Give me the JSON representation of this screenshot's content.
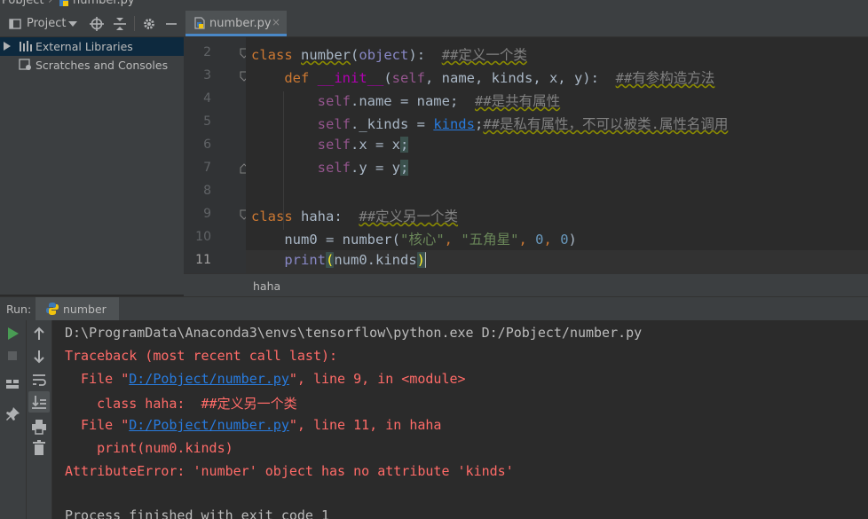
{
  "breadcrumbs": [
    "Pobject",
    "number.py"
  ],
  "project_pane": {
    "title": "Project",
    "items": [
      {
        "label": "External Libraries"
      },
      {
        "label": "Scratches and Consoles"
      }
    ]
  },
  "editor": {
    "tab_label": "number.py",
    "tab_close": "×",
    "line_numbers": [
      "2",
      "3",
      "4",
      "5",
      "6",
      "7",
      "8",
      "9",
      "10",
      "11"
    ],
    "current_line": "11",
    "breadcrumb": "haha",
    "code": {
      "l2_kw": "class",
      "l2_name": "number",
      "l2_paren_open": "(",
      "l2_base": "object",
      "l2_rest": "):",
      "l2_comment": "##定义一个类",
      "l3_kw": "def",
      "l3_name": "__init__",
      "l3_open": "(",
      "l3_params": "self",
      "l3_rest": ", name, kinds, x, y):",
      "l3_comment": "##有参构造方法",
      "l4_self": "self",
      "l4_mid": ".name = name;",
      "l4_comment": "##是共有属性",
      "l5_self": "self",
      "l5_mid": "._kinds = ",
      "l5_link": "kinds",
      "l5_semi": ";",
      "l5_comment": "##是私有属性，不可以被类.属性名调用",
      "l6_self": "self",
      "l6_mid": ".x = x",
      "l6_semi": ";",
      "l7_self": "self",
      "l7_mid": ".y = y",
      "l7_semi": ";",
      "l9_kw": "class",
      "l9_name": "haha",
      "l9_rest": ":",
      "l9_comment": "##定义另一个类",
      "l10_a": "num0 = number(",
      "l10_s1": "\"核心\"",
      "l10_c1": ", ",
      "l10_s2": "\"五角星\"",
      "l10_c2": ", ",
      "l10_n1": "0",
      "l10_c3": ", ",
      "l10_n2": "0",
      "l10_close": ")",
      "l11_fn": "print",
      "l11_open": "(",
      "l11_mid": "num0.kinds",
      "l11_close": ")"
    }
  },
  "run_panel": {
    "label": "Run:",
    "tab_label": "number",
    "lines": {
      "cmd": "D:\\ProgramData\\Anaconda3\\envs\\tensorflow\\python.exe D:/Pobject/number.py",
      "traceback": "Traceback (most recent call last):",
      "file1_pre": "  File \"",
      "file1_link": "D:/Pobject/number.py",
      "file1_post": "\", line 9, in <module>",
      "src1": "    class haha:  ##定义另一个类",
      "file2_pre": "  File \"",
      "file2_link": "D:/Pobject/number.py",
      "file2_post": "\", line 11, in haha",
      "src2": "    print(num0.kinds)",
      "error": "AttributeError: 'number' object has no attribute 'kinds'",
      "finished": "Process finished with exit code 1"
    }
  },
  "icons": [
    "project-icon",
    "dropdown-icon",
    "locate-icon",
    "collapse-icon",
    "gear-icon",
    "minimize-icon",
    "python-file-icon",
    "run-icon",
    "stop-icon",
    "up-icon",
    "down-icon",
    "soft-wrap-icon",
    "scroll-end-icon",
    "layout-icon",
    "pin-icon",
    "print-icon",
    "trash-icon"
  ]
}
